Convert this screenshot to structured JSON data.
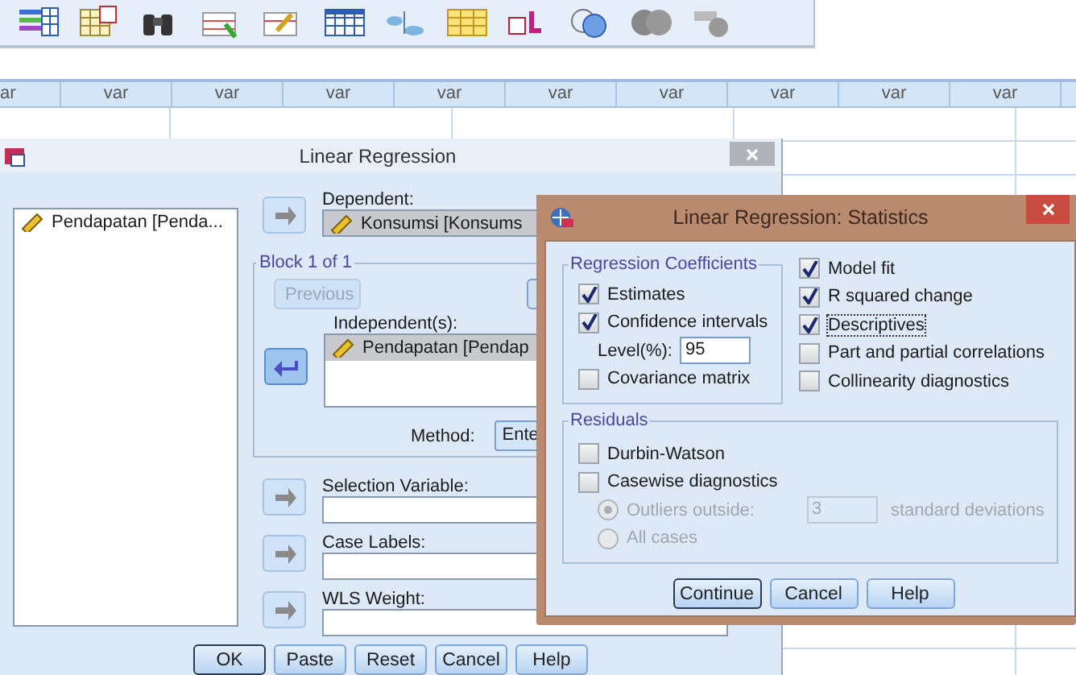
{
  "grid": {
    "columns": [
      "ar",
      "var",
      "var",
      "var",
      "var",
      "var",
      "var",
      "var",
      "var",
      "var"
    ]
  },
  "main_dialog": {
    "title": "Linear Regression",
    "variables": [
      {
        "label": "Pendapatan [Penda...",
        "selected": false
      }
    ],
    "dependent": {
      "label": "Dependent:",
      "arrow": {
        "disabled": true
      },
      "items": [
        {
          "label": "Konsumsi [Konsums",
          "selected": true
        }
      ]
    },
    "block": {
      "label": "Block 1 of 1",
      "previous": {
        "label": "Previous",
        "disabled": true
      },
      "independents": {
        "label": "Independent(s):",
        "arrow": {
          "disabled": false
        },
        "items": [
          {
            "label": "Pendapatan [Pendap",
            "selected": true
          }
        ]
      },
      "method": {
        "label": "Method:",
        "value": "Ente"
      }
    },
    "fields": [
      {
        "label": "Selection Variable:",
        "arrow": {
          "disabled": true
        }
      },
      {
        "label": "Case Labels:",
        "arrow": {
          "disabled": true
        }
      },
      {
        "label": "WLS Weight:",
        "arrow": {
          "disabled": true
        }
      }
    ],
    "buttons": [
      {
        "label": "OK",
        "default": true
      },
      {
        "label": "Paste",
        "default": false
      },
      {
        "label": "Reset",
        "default": false
      },
      {
        "label": "Cancel",
        "default": false
      },
      {
        "label": "Help",
        "default": false
      }
    ]
  },
  "stats_dialog": {
    "title": "Linear Regression: Statistics",
    "coefficients": {
      "label": "Regression Coefficients",
      "items": [
        {
          "kind": "checkbox",
          "label": "Estimates",
          "checked": true
        },
        {
          "kind": "checkbox",
          "label": "Confidence intervals",
          "checked": true
        },
        {
          "kind": "level",
          "label": "Level(%):",
          "value": "95"
        },
        {
          "kind": "checkbox",
          "label": "Covariance matrix",
          "checked": false
        }
      ]
    },
    "options": [
      {
        "label": "Model fit",
        "checked": true,
        "focused": false
      },
      {
        "label": "R squared change",
        "checked": true,
        "focused": false
      },
      {
        "label": "Descriptives",
        "checked": true,
        "focused": true
      },
      {
        "label": "Part and partial correlations",
        "checked": false,
        "focused": false
      },
      {
        "label": "Collinearity diagnostics",
        "checked": false,
        "focused": false
      }
    ],
    "residuals": {
      "label": "Residuals",
      "items": [
        {
          "kind": "checkbox",
          "label": "Durbin-Watson",
          "checked": false
        },
        {
          "kind": "checkbox",
          "label": "Casewise diagnostics",
          "checked": false
        },
        {
          "kind": "radio",
          "label": "Outliers outside:",
          "selected": true,
          "disabled": true,
          "value": "3",
          "suffix": "standard deviations"
        },
        {
          "kind": "radio",
          "label": "All cases",
          "selected": false,
          "disabled": true
        }
      ]
    },
    "buttons": [
      {
        "label": "Continue",
        "default": true
      },
      {
        "label": "Cancel",
        "default": false
      },
      {
        "label": "Help",
        "default": false
      }
    ]
  }
}
